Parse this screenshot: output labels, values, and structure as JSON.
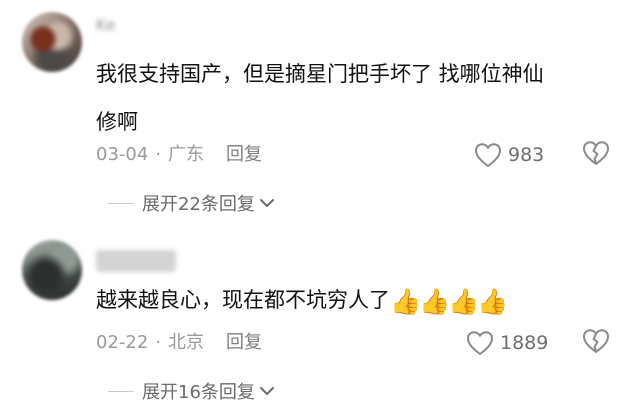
{
  "comments": [
    {
      "username": "Ke",
      "text_line1": "我很支持国产，但是摘星门把手坏了 找哪位神仙",
      "text_line2": "修啊",
      "date": "03-04",
      "location": "广东",
      "reply_label": "回复",
      "likes": "983",
      "expand_label": "展开22条回复"
    },
    {
      "username": "",
      "text": "越来越良心，现在都不坑穷人了",
      "emoji": "👍👍👍👍",
      "date": "02-22",
      "location": "北京",
      "reply_label": "回复",
      "likes": "1889",
      "expand_label": "展开16条回复"
    }
  ],
  "separator": "·",
  "icons": {
    "like": "heart-outline-icon",
    "dislike": "broken-heart-icon",
    "expand": "chevron-down-icon"
  },
  "colors": {
    "text": "#111111",
    "meta": "#9a9a9a",
    "icon": "#8a8a8a"
  }
}
